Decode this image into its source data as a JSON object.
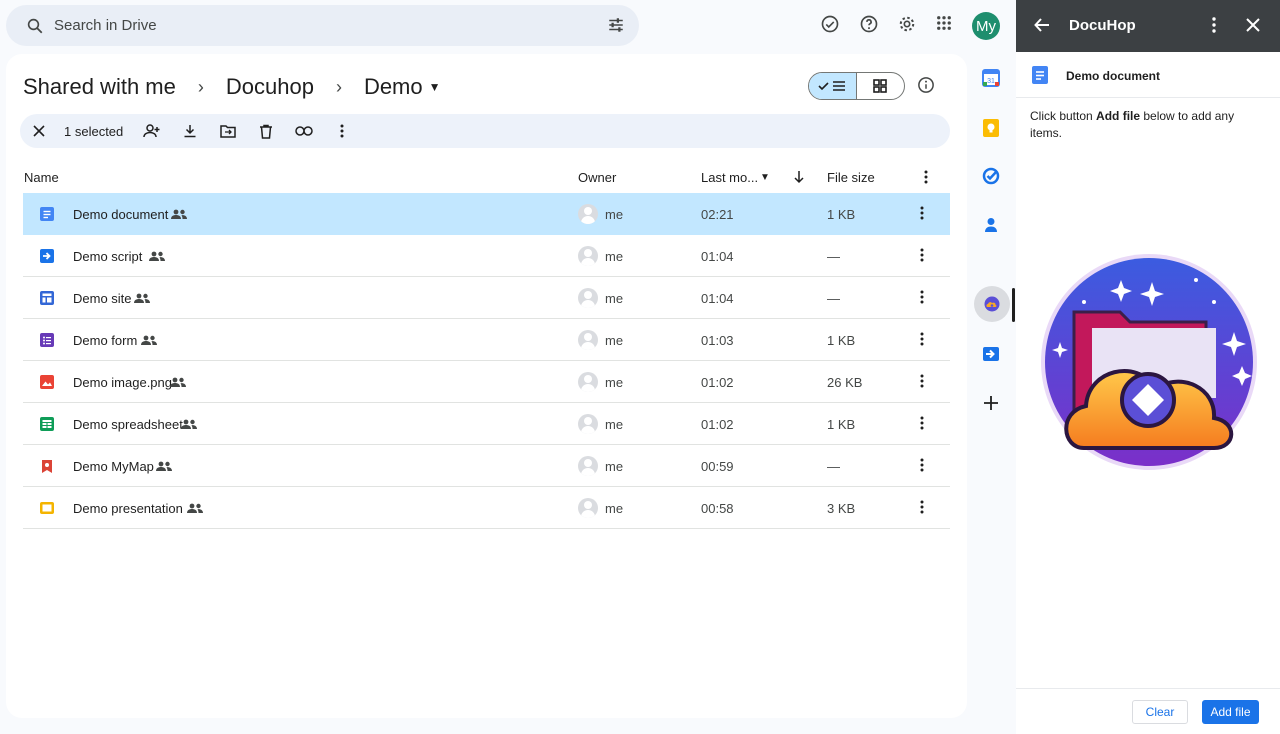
{
  "search": {
    "placeholder": "Search in Drive"
  },
  "account": {
    "initials": "My"
  },
  "breadcrumb": [
    "Shared with me",
    "Docuhop",
    "Demo"
  ],
  "selection": {
    "count_label": "1 selected"
  },
  "table": {
    "headers": {
      "name": "Name",
      "owner": "Owner",
      "modified": "Last mo...",
      "size": "File size"
    },
    "rows": [
      {
        "name": "Demo document",
        "owner": "me",
        "modified": "02:21",
        "size": "1 KB",
        "icon": "docs-icon",
        "color": "#4285f4"
      },
      {
        "name": "Demo script",
        "owner": "me",
        "modified": "01:04",
        "size": "—",
        "icon": "apps-script-icon",
        "color": "#1a73e8"
      },
      {
        "name": "Demo site",
        "owner": "me",
        "modified": "01:04",
        "size": "—",
        "icon": "sites-icon",
        "color": "#3367d6"
      },
      {
        "name": "Demo form",
        "owner": "me",
        "modified": "01:03",
        "size": "1 KB",
        "icon": "forms-icon",
        "color": "#673ab7"
      },
      {
        "name": "Demo image.png",
        "owner": "me",
        "modified": "01:02",
        "size": "26 KB",
        "icon": "image-icon",
        "color": "#ea4335"
      },
      {
        "name": "Demo spreadsheet",
        "owner": "me",
        "modified": "01:02",
        "size": "1 KB",
        "icon": "sheets-icon",
        "color": "#0f9d58"
      },
      {
        "name": "Demo MyMap",
        "owner": "me",
        "modified": "00:59",
        "size": "—",
        "icon": "mymaps-icon",
        "color": "#db4437"
      },
      {
        "name": "Demo presentation",
        "owner": "me",
        "modified": "00:58",
        "size": "3 KB",
        "icon": "slides-icon",
        "color": "#f4b400"
      }
    ]
  },
  "panel": {
    "title": "DocuHop",
    "document": "Demo document",
    "help_prefix": "Click button ",
    "help_bold": "Add file",
    "help_suffix": " below to add any items.",
    "clear_label": "Clear",
    "add_label": "Add file"
  },
  "colors": {
    "accent": "#1a73e8",
    "selected_row": "#c2e7ff",
    "panel_header": "#3c4043"
  }
}
